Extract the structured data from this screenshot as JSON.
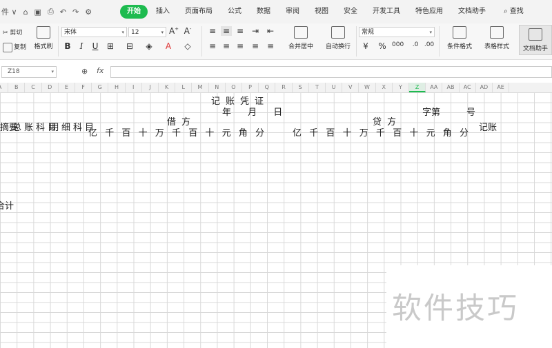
{
  "quick_bar": {
    "icons": [
      "file-menu-icon",
      "home-icon",
      "save-icon",
      "print-icon",
      "undo-icon",
      "redo-icon",
      "settings-icon"
    ],
    "menu_label": "件 ∨"
  },
  "menu_tabs": [
    "开始",
    "插入",
    "页面布局",
    "公式",
    "数据",
    "审阅",
    "视图",
    "安全",
    "开发工具",
    "特色应用",
    "文档助手"
  ],
  "search_label": "查找",
  "ribbon": {
    "cut": "剪切",
    "copy": "复制",
    "format_painter": "格式刷",
    "font_name": "宋体",
    "font_size": "12",
    "number_format": "常规",
    "merge_center": "合并居中",
    "wrap_text": "自动换行",
    "condition_format": "条件格式",
    "table_style": "表格样式",
    "doc_assistant": "文档助手"
  },
  "formula_bar": {
    "name_box": "Z18",
    "fx": "fx",
    "value": ""
  },
  "columns": [
    "A",
    "B",
    "C",
    "D",
    "E",
    "F",
    "G",
    "H",
    "I",
    "J",
    "K",
    "L",
    "M",
    "N",
    "O",
    "P",
    "Q",
    "R",
    "S",
    "T",
    "U",
    "V",
    "W",
    "X",
    "Y",
    "Z",
    "AA",
    "AB",
    "AC",
    "AD",
    "AE"
  ],
  "selected_column": "Z",
  "sheet": {
    "title": "记账凭证",
    "date": "年 月 日",
    "zihao": "字第",
    "hao": "号",
    "summary": "摘要",
    "general_account": "总账科目",
    "sub_account": "明细科目",
    "debit": "借方",
    "credit": "贷方",
    "ledger": "记账",
    "units": [
      "亿",
      "千",
      "百",
      "十",
      "万",
      "千",
      "百",
      "十",
      "元",
      "角",
      "分"
    ],
    "total": "合计"
  },
  "watermark": "软件技巧"
}
